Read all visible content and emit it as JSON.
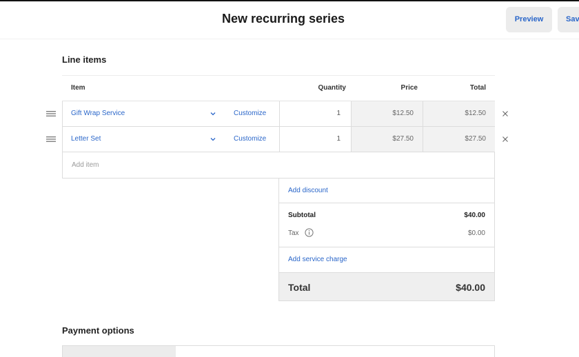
{
  "header": {
    "title": "New recurring series",
    "preview_label": "Preview",
    "save_label": "Save"
  },
  "line_items": {
    "section_title": "Line items",
    "columns": {
      "item": "Item",
      "quantity": "Quantity",
      "price": "Price",
      "total": "Total"
    },
    "rows": [
      {
        "item": "Gift Wrap Service",
        "customize": "Customize",
        "quantity": "1",
        "price": "$12.50",
        "total": "$12.50"
      },
      {
        "item": "Letter Set",
        "customize": "Customize",
        "quantity": "1",
        "price": "$27.50",
        "total": "$27.50"
      }
    ],
    "add_item_placeholder": "Add item"
  },
  "summary": {
    "add_discount": "Add discount",
    "subtotal_label": "Subtotal",
    "subtotal_value": "$40.00",
    "tax_label": "Tax",
    "tax_value": "$0.00",
    "add_service_charge": "Add service charge",
    "total_label": "Total",
    "total_value": "$40.00"
  },
  "payment": {
    "section_title": "Payment options"
  },
  "icons": {
    "drag": "drag-handle-icon",
    "chevron": "chevron-down-icon",
    "remove": "close-icon",
    "info": "info-icon"
  },
  "colors": {
    "link": "#2a66c9",
    "button_bg": "#ececec",
    "readonly_bg": "#f2f2f2",
    "border": "#dcdcdc"
  }
}
